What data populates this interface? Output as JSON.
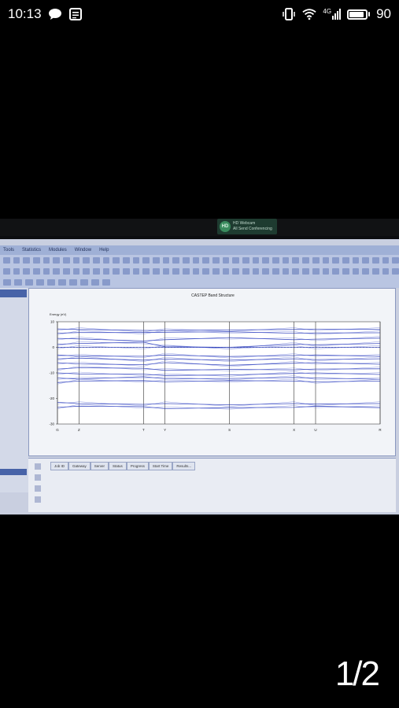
{
  "status_bar": {
    "time": "10:13",
    "network": "4G",
    "battery": "90",
    "battery_fraction": 0.9,
    "icons": [
      "chat-icon",
      "notes-icon",
      "vibrate-icon",
      "wifi-icon",
      "signal-icon",
      "battery-icon"
    ]
  },
  "notification": {
    "line1": "HD Webcam",
    "line2": "All Send Conferencing",
    "icon_text": "HD"
  },
  "app": {
    "menu": [
      "Tools",
      "Statistics",
      "Modules",
      "Window",
      "Help"
    ]
  },
  "chart_data": {
    "type": "line",
    "title": "CASTEP Band Structure",
    "ylabel": "Energy (eV)",
    "xlabel": "",
    "yticks": [
      10,
      0,
      -10,
      -20,
      -30
    ],
    "ylim": [
      -30,
      10
    ],
    "xticks": [
      "G",
      "Z",
      "T",
      "Y",
      "S",
      "X",
      "U",
      "R"
    ],
    "x_positions": [
      0,
      1,
      4,
      5,
      8,
      11,
      12,
      15
    ],
    "series_note": "",
    "series": [
      {
        "values": [
          7.2,
          7.0,
          6.6,
          6.6,
          6.8,
          7.0,
          7.1,
          7.0
        ]
      },
      {
        "values": [
          5.5,
          5.8,
          5.8,
          5.9,
          6.1,
          5.5,
          5.6,
          5.7
        ]
      },
      {
        "values": [
          3.5,
          3.3,
          2.5,
          3.0,
          3.8,
          3.0,
          3.2,
          3.6
        ]
      },
      {
        "values": [
          1.2,
          1.5,
          2.0,
          0.2,
          0.0,
          1.2,
          1.0,
          1.5
        ]
      },
      {
        "values": [
          0.0,
          0.0,
          0.0,
          0.0,
          0.0,
          0.0,
          0.0,
          0.0
        ]
      },
      {
        "values": [
          -3.0,
          -3.4,
          -3.5,
          -3.0,
          -3.6,
          -3.2,
          -3.0,
          -3.5
        ]
      },
      {
        "values": [
          -4.5,
          -4.2,
          -5.0,
          -4.6,
          -5.0,
          -4.5,
          -4.8,
          -4.5
        ]
      },
      {
        "values": [
          -6.0,
          -6.5,
          -6.8,
          -6.0,
          -7.0,
          -6.2,
          -6.0,
          -6.6
        ]
      },
      {
        "values": [
          -8.5,
          -8.0,
          -8.2,
          -9.0,
          -8.6,
          -8.8,
          -8.5,
          -8.4
        ]
      },
      {
        "values": [
          -10.0,
          -10.4,
          -10.5,
          -11.0,
          -10.8,
          -10.2,
          -10.0,
          -10.6
        ]
      },
      {
        "values": [
          -12.0,
          -12.4,
          -11.5,
          -12.3,
          -12.2,
          -11.8,
          -12.0,
          -12.5
        ]
      },
      {
        "values": [
          -13.8,
          -13.2,
          -13.0,
          -13.5,
          -13.0,
          -13.2,
          -13.5,
          -13.2
        ]
      },
      {
        "values": [
          -21.5,
          -22.0,
          -22.3,
          -22.0,
          -22.5,
          -22.0,
          -22.2,
          -22.0
        ]
      },
      {
        "values": [
          -23.5,
          -23.0,
          -23.2,
          -24.0,
          -23.6,
          -23.5,
          -23.0,
          -23.6
        ]
      }
    ],
    "fermi_level": 0,
    "grid": false
  },
  "jobs": {
    "columns": [
      "Job ID",
      "Gateway",
      "Server",
      "Status",
      "Progress",
      "Start Time",
      "Results..."
    ]
  },
  "page_indicator": "1/2"
}
